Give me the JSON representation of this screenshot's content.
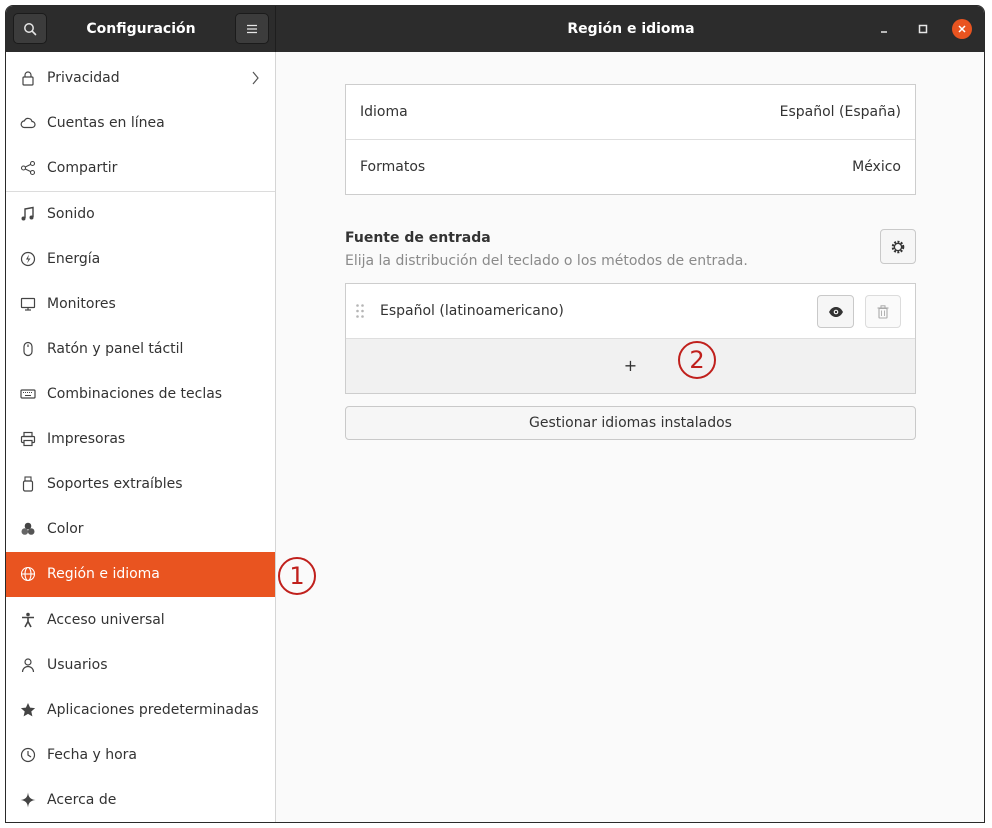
{
  "header": {
    "sidebar_title": "Configuración",
    "page_title": "Región e idioma"
  },
  "sidebar": {
    "items": [
      {
        "label": "Privacidad",
        "icon": "lock-icon"
      },
      {
        "label": "Cuentas en línea",
        "icon": "cloud-icon"
      },
      {
        "label": "Compartir",
        "icon": "share-icon"
      },
      {
        "label": "Sonido",
        "icon": "music-note-icon"
      },
      {
        "label": "Energía",
        "icon": "power-icon"
      },
      {
        "label": "Monitores",
        "icon": "monitor-icon"
      },
      {
        "label": "Ratón y panel táctil",
        "icon": "mouse-icon"
      },
      {
        "label": "Combinaciones de teclas",
        "icon": "keyboard-icon"
      },
      {
        "label": "Impresoras",
        "icon": "printer-icon"
      },
      {
        "label": "Soportes extraíbles",
        "icon": "usb-drive-icon"
      },
      {
        "label": "Color",
        "icon": "color-icon"
      },
      {
        "label": "Región e idioma",
        "icon": "globe-icon"
      },
      {
        "label": "Acceso universal",
        "icon": "accessibility-icon"
      },
      {
        "label": "Usuarios",
        "icon": "users-icon"
      },
      {
        "label": "Aplicaciones predeterminadas",
        "icon": "star-icon"
      },
      {
        "label": "Fecha y hora",
        "icon": "clock-icon"
      },
      {
        "label": "Acerca de",
        "icon": "sparkle-icon"
      }
    ]
  },
  "main": {
    "language": {
      "label": "Idioma",
      "value": "Español (España)"
    },
    "formats": {
      "label": "Formatos",
      "value": "México"
    },
    "input_sources": {
      "title": "Fuente de entrada",
      "subtitle": "Elija la distribución del teclado o los métodos de entrada.",
      "items": [
        {
          "label": "Español (latinoamericano)"
        }
      ],
      "add_symbol": "+"
    },
    "manage_button": "Gestionar idiomas instalados"
  },
  "annotations": [
    "1",
    "2"
  ],
  "colors": {
    "accent": "#e95420",
    "header_bg": "#2c2c2c",
    "annotation": "#c0201c"
  }
}
